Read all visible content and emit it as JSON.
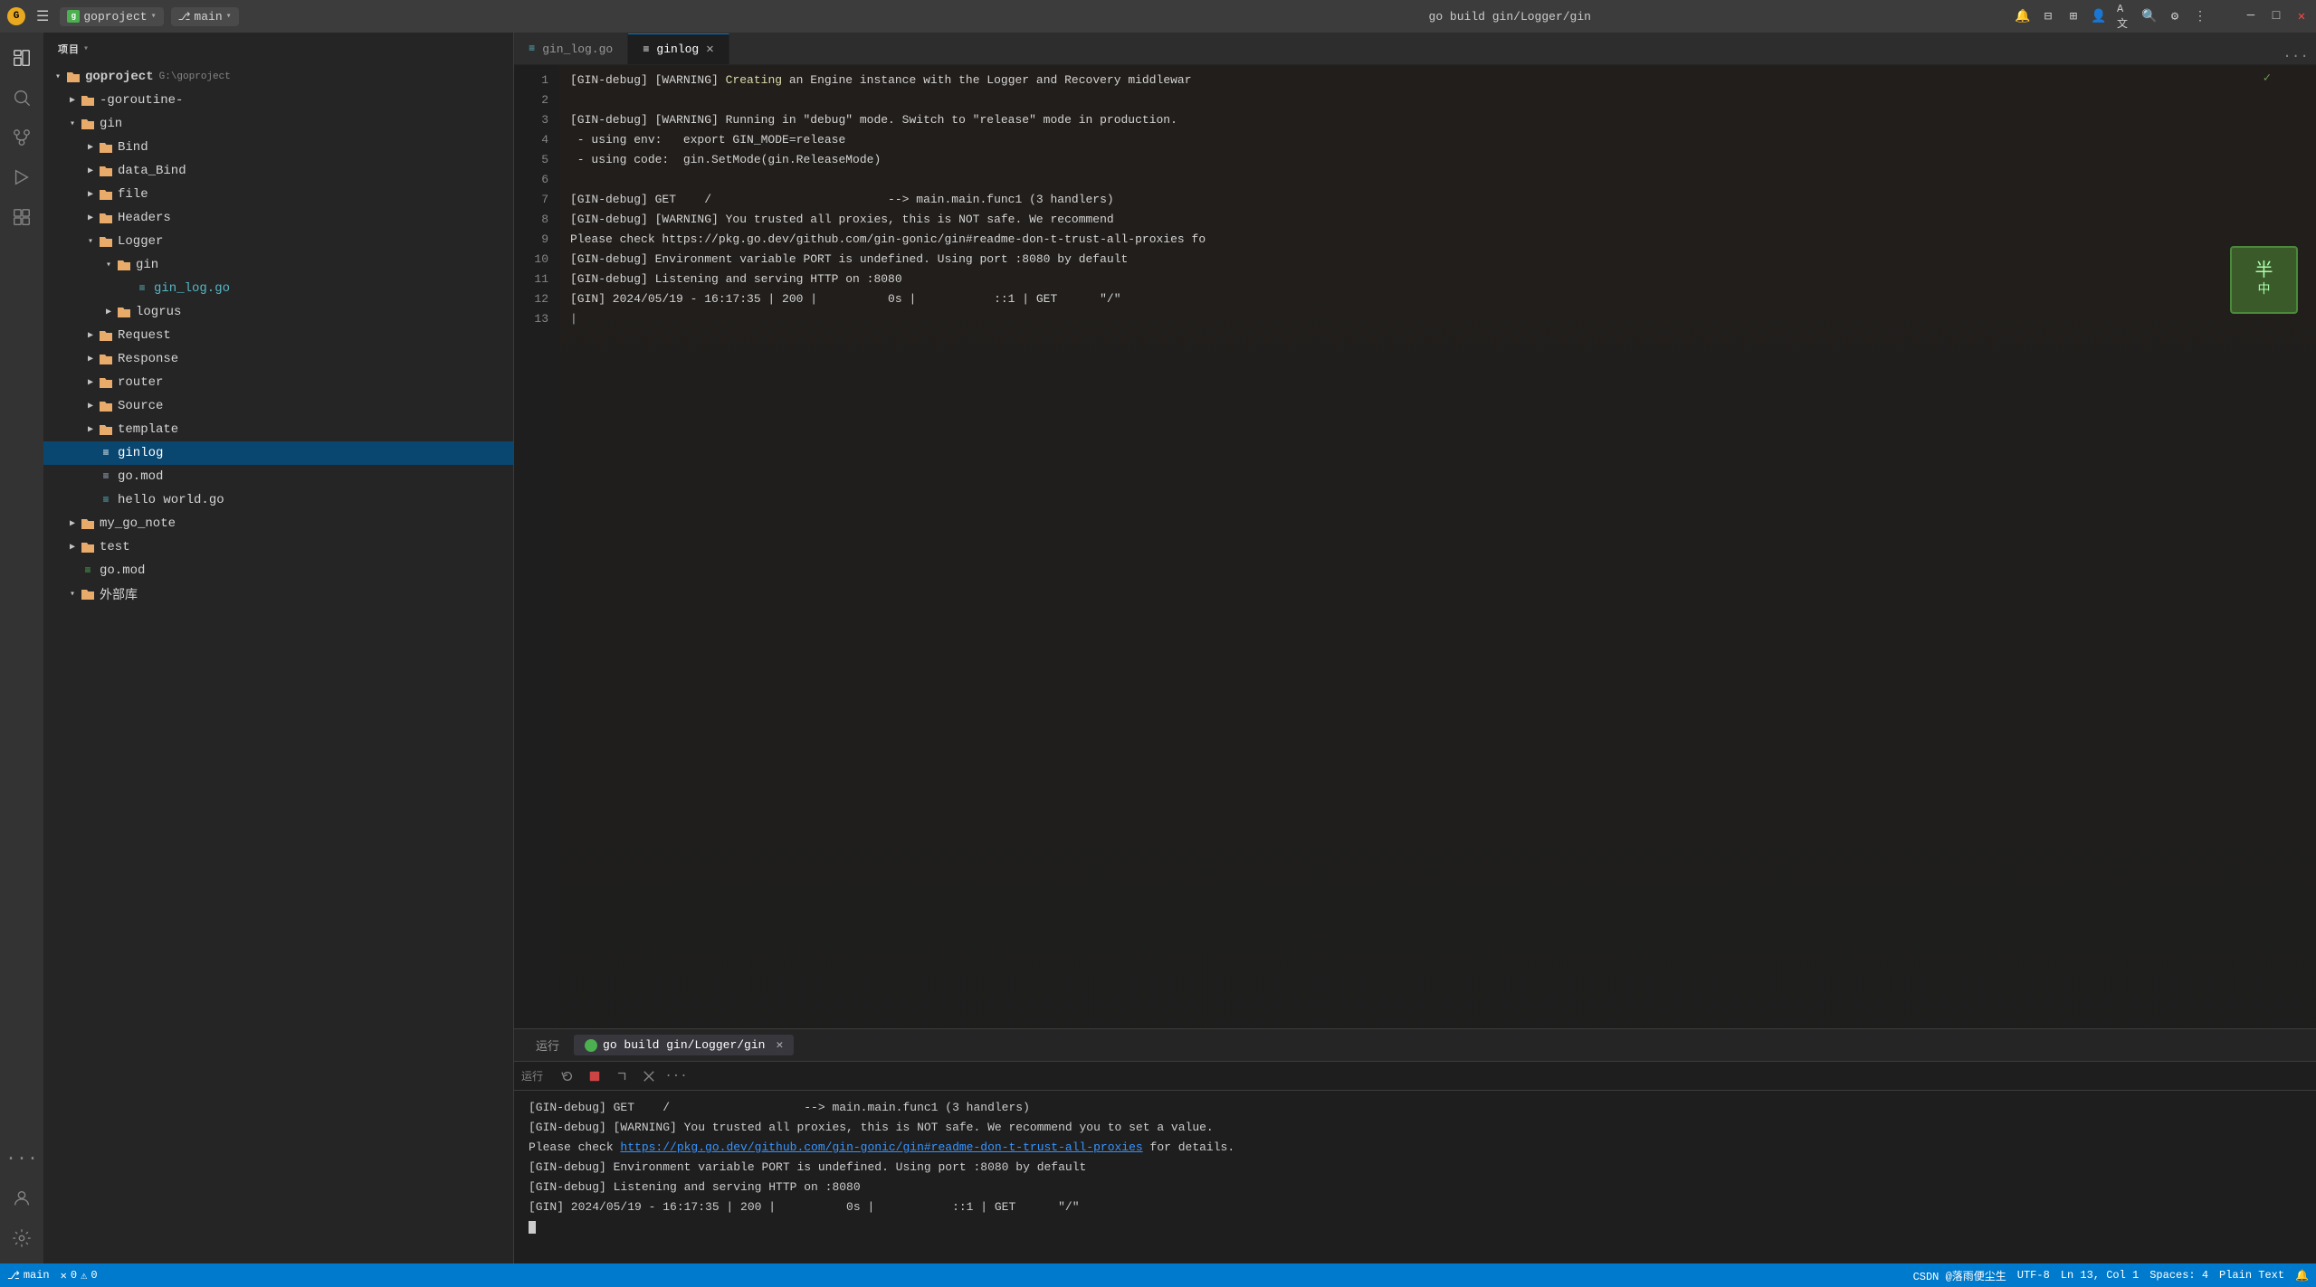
{
  "titleBar": {
    "appIcon": "G",
    "menuIcon": "☰",
    "projectName": "goproject",
    "projectIcon": "g",
    "branchName": "main",
    "buildTitle": "go build gin/Logger/gin",
    "windowControls": {
      "minimize": "─",
      "maximize": "□",
      "close": "✕"
    }
  },
  "activityBar": {
    "items": [
      {
        "name": "explorer-icon",
        "icon": "📋",
        "label": "Explorer"
      },
      {
        "name": "search-icon",
        "icon": "🔍",
        "label": "Search"
      },
      {
        "name": "source-control-icon",
        "icon": "⎇",
        "label": "Source Control"
      },
      {
        "name": "run-debug-icon",
        "icon": "▷",
        "label": "Run and Debug"
      },
      {
        "name": "extensions-icon",
        "icon": "⊞",
        "label": "Extensions"
      }
    ],
    "bottomItems": [
      {
        "name": "accounts-icon",
        "icon": "👤",
        "label": "Accounts"
      },
      {
        "name": "settings-icon",
        "icon": "⚙",
        "label": "Settings"
      }
    ]
  },
  "sidebar": {
    "header": "项目",
    "tree": {
      "root": "goproject",
      "rootPath": "G:\\goproject",
      "items": [
        {
          "id": "goroutine",
          "label": "-goroutine-",
          "type": "folder",
          "depth": 1,
          "expanded": false
        },
        {
          "id": "gin",
          "label": "gin",
          "type": "folder",
          "depth": 1,
          "expanded": true
        },
        {
          "id": "Bind",
          "label": "Bind",
          "type": "folder",
          "depth": 2,
          "expanded": false
        },
        {
          "id": "data_Bind",
          "label": "data_Bind",
          "type": "folder",
          "depth": 2,
          "expanded": false
        },
        {
          "id": "file",
          "label": "file",
          "type": "folder",
          "depth": 2,
          "expanded": false
        },
        {
          "id": "Headers",
          "label": "Headers",
          "type": "folder",
          "depth": 2,
          "expanded": false
        },
        {
          "id": "Logger",
          "label": "Logger",
          "type": "folder",
          "depth": 2,
          "expanded": true
        },
        {
          "id": "gin_inner",
          "label": "gin",
          "type": "folder",
          "depth": 3,
          "expanded": true
        },
        {
          "id": "gin_log_go",
          "label": "gin_log.go",
          "type": "file-go",
          "depth": 4
        },
        {
          "id": "logrus",
          "label": "logrus",
          "type": "folder",
          "depth": 3,
          "expanded": false
        },
        {
          "id": "Request",
          "label": "Request",
          "type": "folder",
          "depth": 2,
          "expanded": false
        },
        {
          "id": "Response",
          "label": "Response",
          "type": "folder",
          "depth": 2,
          "expanded": false
        },
        {
          "id": "router",
          "label": "router",
          "type": "folder",
          "depth": 2,
          "expanded": false
        },
        {
          "id": "Source",
          "label": "Source",
          "type": "folder",
          "depth": 2,
          "expanded": false
        },
        {
          "id": "template",
          "label": "template",
          "type": "folder",
          "depth": 2,
          "expanded": false
        },
        {
          "id": "ginlog",
          "label": "ginlog",
          "type": "file-ginlog",
          "depth": 2,
          "active": true
        },
        {
          "id": "go_mod_gin",
          "label": "go.mod",
          "type": "file-mod",
          "depth": 2
        },
        {
          "id": "hello_world_go",
          "label": "hello world.go",
          "type": "file-go",
          "depth": 2
        },
        {
          "id": "my_go_note",
          "label": "my_go_note",
          "type": "folder",
          "depth": 1,
          "expanded": false
        },
        {
          "id": "test",
          "label": "test",
          "type": "folder",
          "depth": 1,
          "expanded": false
        },
        {
          "id": "go_mod_root",
          "label": "go.mod",
          "type": "file-mod",
          "depth": 1
        },
        {
          "id": "waibu",
          "label": "外部库",
          "type": "folder",
          "depth": 1,
          "expanded": false
        }
      ]
    }
  },
  "editor": {
    "tabs": [
      {
        "id": "gin_log_go",
        "label": "gin_log.go",
        "active": false,
        "icon": "≡"
      },
      {
        "id": "ginlog",
        "label": "ginlog",
        "active": true,
        "icon": "≡",
        "closable": true
      }
    ],
    "lines": [
      {
        "num": 1,
        "text": "[GIN-debug] [WARNING] Creating an Engine instance with the Logger and Recovery middlewar",
        "checkmark": true
      },
      {
        "num": 2,
        "text": ""
      },
      {
        "num": 3,
        "text": "[GIN-debug] [WARNING] Running in \"debug\" mode. Switch to \"release\" mode in production."
      },
      {
        "num": 4,
        "text": " - using env:   export GIN_MODE=release"
      },
      {
        "num": 5,
        "text": " - using code:  gin.SetMode(gin.ReleaseMode)"
      },
      {
        "num": 6,
        "text": ""
      },
      {
        "num": 7,
        "text": "[GIN-debug] GET    /                         --> main.main.func1 (3 handlers)"
      },
      {
        "num": 8,
        "text": "[GIN-debug] [WARNING] You trusted all proxies, this is NOT safe. We recommend"
      },
      {
        "num": 9,
        "text": "Please check https://pkg.go.dev/github.com/gin-gonic/gin#readme-don-t-trust-all-proxies fo"
      },
      {
        "num": 10,
        "text": "[GIN-debug] Environment variable PORT is undefined. Using port :8080 by default"
      },
      {
        "num": 11,
        "text": "[GIN-debug] Listening and serving HTTP on :8080"
      },
      {
        "num": 12,
        "text": "[GIN] 2024/05/19 - 16:17:35 | 200 |          0s |           ::1 | GET      \"/\""
      },
      {
        "num": 13,
        "text": "",
        "cursor": true
      }
    ]
  },
  "bottomPanel": {
    "tabs": [
      {
        "id": "run-tab",
        "label": "运行",
        "active": false
      },
      {
        "id": "terminal-tab",
        "label": "go build gin/Logger/gin",
        "active": true,
        "hasIcon": true
      }
    ],
    "toolbar": {
      "label": "运行",
      "buttons": [
        "restart",
        "stop",
        "step-over",
        "clear",
        "more"
      ]
    },
    "terminalLines": [
      "[GIN-debug] GET    /                   --> main.main.func1 (3 handlers)",
      "[GIN-debug] [WARNING] You trusted all proxies, this is NOT safe. We recommend you to set a value.",
      "Please check https://pkg.go.dev/github.com/gin-gonic/gin#readme-don-t-trust-all-proxies for details.",
      "[GIN-debug] Environment variable PORT is undefined. Using port :8080 by default",
      "[GIN-debug] Listening and serving HTTP on :8080",
      "[GIN] 2024/05/19 - 16:17:35 | 200 |          0s |           ::1 | GET      \"/\""
    ],
    "link": "https://pkg.go.dev/github.com/gin-gonic/gin#readme-don-t-trust-all-proxies"
  },
  "statusBar": {
    "left": [
      "CSDN @落雨便尘生"
    ]
  },
  "rightIcons": [
    {
      "name": "notification-icon",
      "icon": "🔔"
    },
    {
      "name": "layout-icon",
      "icon": "⊟"
    },
    {
      "name": "remote-icon",
      "icon": "⊞"
    },
    {
      "name": "account-icon",
      "icon": "⊡"
    },
    {
      "name": "translate-icon",
      "icon": "A文"
    },
    {
      "name": "search-global-icon",
      "icon": "🔍"
    },
    {
      "name": "settings2-icon",
      "icon": "⚙"
    },
    {
      "name": "more2-icon",
      "icon": "⋮"
    }
  ]
}
